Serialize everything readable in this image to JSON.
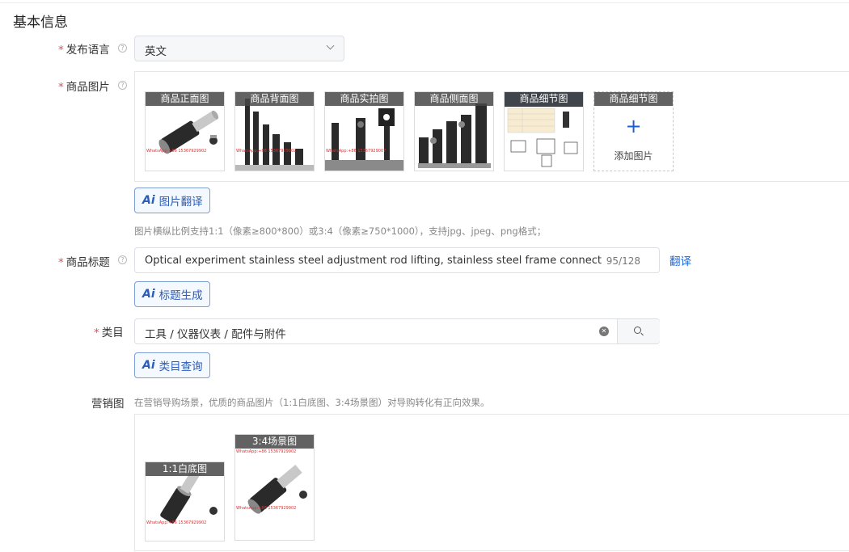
{
  "section_title": "基本信息",
  "fields": {
    "language": {
      "label": "发布语言",
      "required_mark": "*",
      "help_icon": "question-circle-icon",
      "value": "英文",
      "dropdown_icon": "chevron-down-icon"
    },
    "images": {
      "label": "商品图片",
      "required_mark": "*",
      "help_icon": "question-circle-icon",
      "thumbnails": [
        {
          "caption": "商品正面图",
          "watermark": "WhatsApp:+86 15367929902"
        },
        {
          "caption": "商品背面图",
          "watermark": "WhatsApp:+86 15367929902"
        },
        {
          "caption": "商品实拍图",
          "watermark": "WhatsApp:+86 15367929007"
        },
        {
          "caption": "商品侧面图",
          "watermark": ""
        },
        {
          "caption": "商品细节图",
          "watermark": ""
        }
      ],
      "add_slot": {
        "caption": "商品细节图",
        "plus": "+",
        "label": "添加图片"
      },
      "ai_button": {
        "ai": "Ai",
        "label": "图片翻译"
      },
      "hint": "图片横纵比例支持1:1（像素≥800*800）或3:4（像素≥750*1000），支持jpg、jpeg、png格式；"
    },
    "title": {
      "label": "商品标题",
      "required_mark": "*",
      "help_icon": "question-circle-icon",
      "value": "Optical experiment stainless steel adjustment rod lifting, stainless steel frame connecting rod",
      "counter": "95/128",
      "translate_link": "翻译",
      "ai_button": {
        "ai": "Ai",
        "label": "标题生成"
      }
    },
    "category": {
      "label": "类目",
      "required_mark": "*",
      "value": "工具 / 仪器仪表 / 配件与附件",
      "clear_icon": "clear-circle-icon",
      "search_icon": "search-icon",
      "ai_button": {
        "ai": "Ai",
        "label": "类目查询"
      }
    },
    "marketing": {
      "label": "营销图",
      "hint": "在营销导购场景，优质的商品图片（1:1白底图、3:4场景图）对导购转化有正向效果。",
      "thumbnails": [
        {
          "caption": "1:1白底图",
          "watermark": "WhatsApp:+86 15367929902"
        },
        {
          "caption": "3:4场景图",
          "watermark": "WhatsApp:+86 15367929902"
        }
      ]
    }
  },
  "colors": {
    "accent": "#1a66d9",
    "required": "#e34d59",
    "ai_border": "#7d9fd6",
    "caption_bg": "#464646",
    "product_dark": "#2a2a2a",
    "watermark": "#e03030"
  }
}
